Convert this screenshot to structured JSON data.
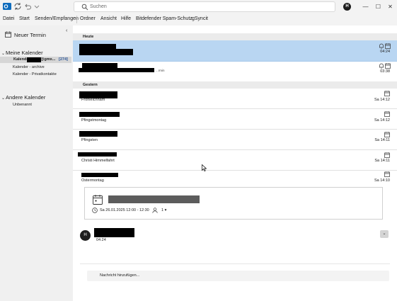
{
  "titlebar": {
    "search_placeholder": "Suchen",
    "profile_initial": "H",
    "window_buttons": [
      "—",
      "☐",
      "✕"
    ]
  },
  "menu": [
    "Datei",
    "Start",
    "Senden/Empfangen",
    "Ordner",
    "Ansicht",
    "Hilfe",
    "Bitdefender Spam-Schutz",
    "gSyncit"
  ],
  "sidebar": {
    "new_appointment": "Neuer Termin",
    "my_calendars": "Meine Kalender",
    "calendars": [
      {
        "label_prefix": "Kalender - ",
        "label_suffix": "@gmx...",
        "count": "[274]",
        "selected": true
      },
      {
        "label": "Kalender - archive"
      },
      {
        "label": "Kalender - Privatkontakte"
      }
    ],
    "other_calendars": "Andere Kalender",
    "other_items": [
      "Unbenannt"
    ]
  },
  "list": {
    "today_header": "Heute",
    "today_rows": [
      {
        "time": "04:24",
        "selected": true
      },
      {
        "time": "03:38",
        "tail": "...rmin"
      }
    ],
    "yesterday_header": "Gestern",
    "yesterday_rows": [
      {
        "subject": "Fronleichnam",
        "time": "Sa 14:12"
      },
      {
        "subject": "Pfingstmontag",
        "time": "Sa 14:12"
      },
      {
        "subject": "Pfingsten",
        "time": "Sa 14:11"
      },
      {
        "subject": "Christi Himmelfahrt",
        "time": "Sa 14:11"
      },
      {
        "subject": "Ostermontag",
        "time": "Sa 14:10"
      }
    ]
  },
  "preview": {
    "when": "Sa 26.01.2025 12:00 - 12:30",
    "attendees": "1",
    "sender_initial": "H",
    "sent_time": "04:24",
    "reply_placeholder": "Nachricht hinzufügen..."
  },
  "colors": {
    "selection": "#b9d6f2",
    "accent_text": "#2b579a",
    "outlook_blue": "#0f6cbd"
  }
}
